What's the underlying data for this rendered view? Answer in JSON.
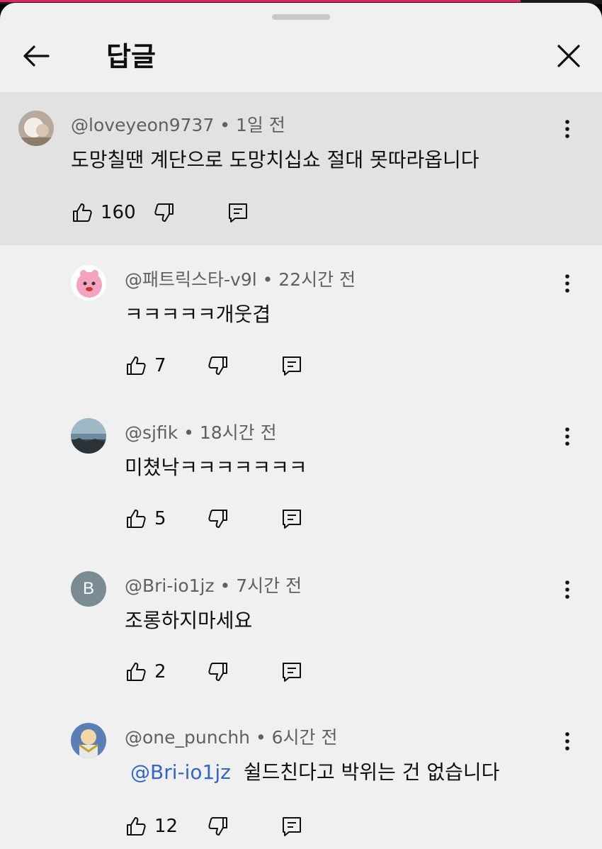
{
  "header": {
    "title": "답글"
  },
  "parent": {
    "author": "@loveyeon9737 • 1일 전",
    "text": "도망칠땐 계단으로 도망치십쇼 절대 못따라옵니다",
    "likes": "160"
  },
  "replies": [
    {
      "author": "@패트릭스타-v9l • 22시간 전",
      "text": "ㅋㅋㅋㅋㅋ개웃겹",
      "likes": "7"
    },
    {
      "author": "@sjfik • 18시간 전",
      "text": "미쳤낙ㅋㅋㅋㅋㅋㅋㅋ",
      "likes": "5"
    },
    {
      "author": "@Bri-io1jz • 7시간 전",
      "avatar_letter": "B",
      "text": "조롱하지마세요",
      "likes": "2"
    },
    {
      "author": "@one_punchh • 6시간 전",
      "mention": "@Bri-io1jz",
      "text": "쉴드친다고 박위는 건 없습니다",
      "likes": "12"
    }
  ],
  "colors": {
    "accent": "#e0245e",
    "mention": "#3366cc",
    "avatar_b": "#7b8b94"
  }
}
